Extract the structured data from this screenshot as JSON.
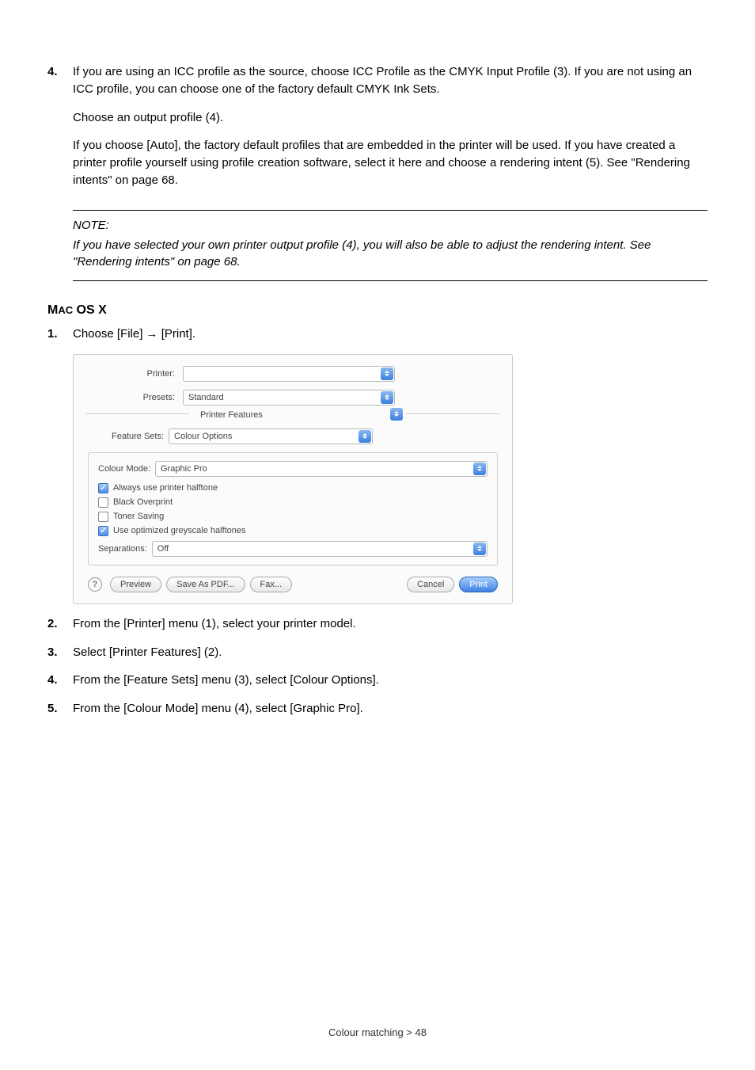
{
  "step4_top": {
    "num": "4.",
    "text": "If you are using an ICC profile as the source, choose ICC Profile as the CMYK Input Profile (3). If you are not using an ICC profile, you can choose one of the factory default CMYK Ink Sets.",
    "after1": "Choose an output profile (4).",
    "after2": "If you choose [Auto], the factory default profiles that are embedded in the printer will be used. If you have created a printer profile yourself using profile creation software, select it here and choose a rendering intent (5). See \"Rendering intents\" on page 68."
  },
  "note": {
    "label": "NOTE:",
    "body": "If you have selected your own printer output profile (4), you will also be able to adjust the rendering intent. See \"Rendering intents\" on page 68."
  },
  "subhead_prefix": "M",
  "subhead_small": "AC",
  "subhead_rest": " OS X",
  "mac_step1": {
    "num": "1.",
    "text": "Choose [File] → [Print]."
  },
  "dialog": {
    "printer_label": "Printer:",
    "printer_value": "",
    "presets_label": "Presets:",
    "presets_value": "Standard",
    "features_label": "Printer Features",
    "feature_sets_label": "Feature Sets:",
    "feature_sets_value": "Colour Options",
    "colour_mode_label": "Colour Mode:",
    "colour_mode_value": "Graphic Pro",
    "ck_halftone": "Always use printer halftone",
    "ck_black": "Black Overprint",
    "ck_toner": "Toner Saving",
    "ck_grey": "Use optimized greyscale halftones",
    "sep_label": "Separations:",
    "sep_value": "Off",
    "help": "?",
    "preview": "Preview",
    "savepdf": "Save As PDF...",
    "fax": "Fax...",
    "cancel": "Cancel",
    "print": "Print"
  },
  "step2": {
    "num": "2.",
    "text": "From the [Printer] menu (1), select your printer model."
  },
  "step3": {
    "num": "3.",
    "text": "Select [Printer Features] (2)."
  },
  "step4": {
    "num": "4.",
    "text": "From the [Feature Sets] menu (3), select [Colour Options]."
  },
  "step5": {
    "num": "5.",
    "text": "From the [Colour Mode] menu (4), select [Graphic Pro]."
  },
  "footer": "Colour matching > 48"
}
